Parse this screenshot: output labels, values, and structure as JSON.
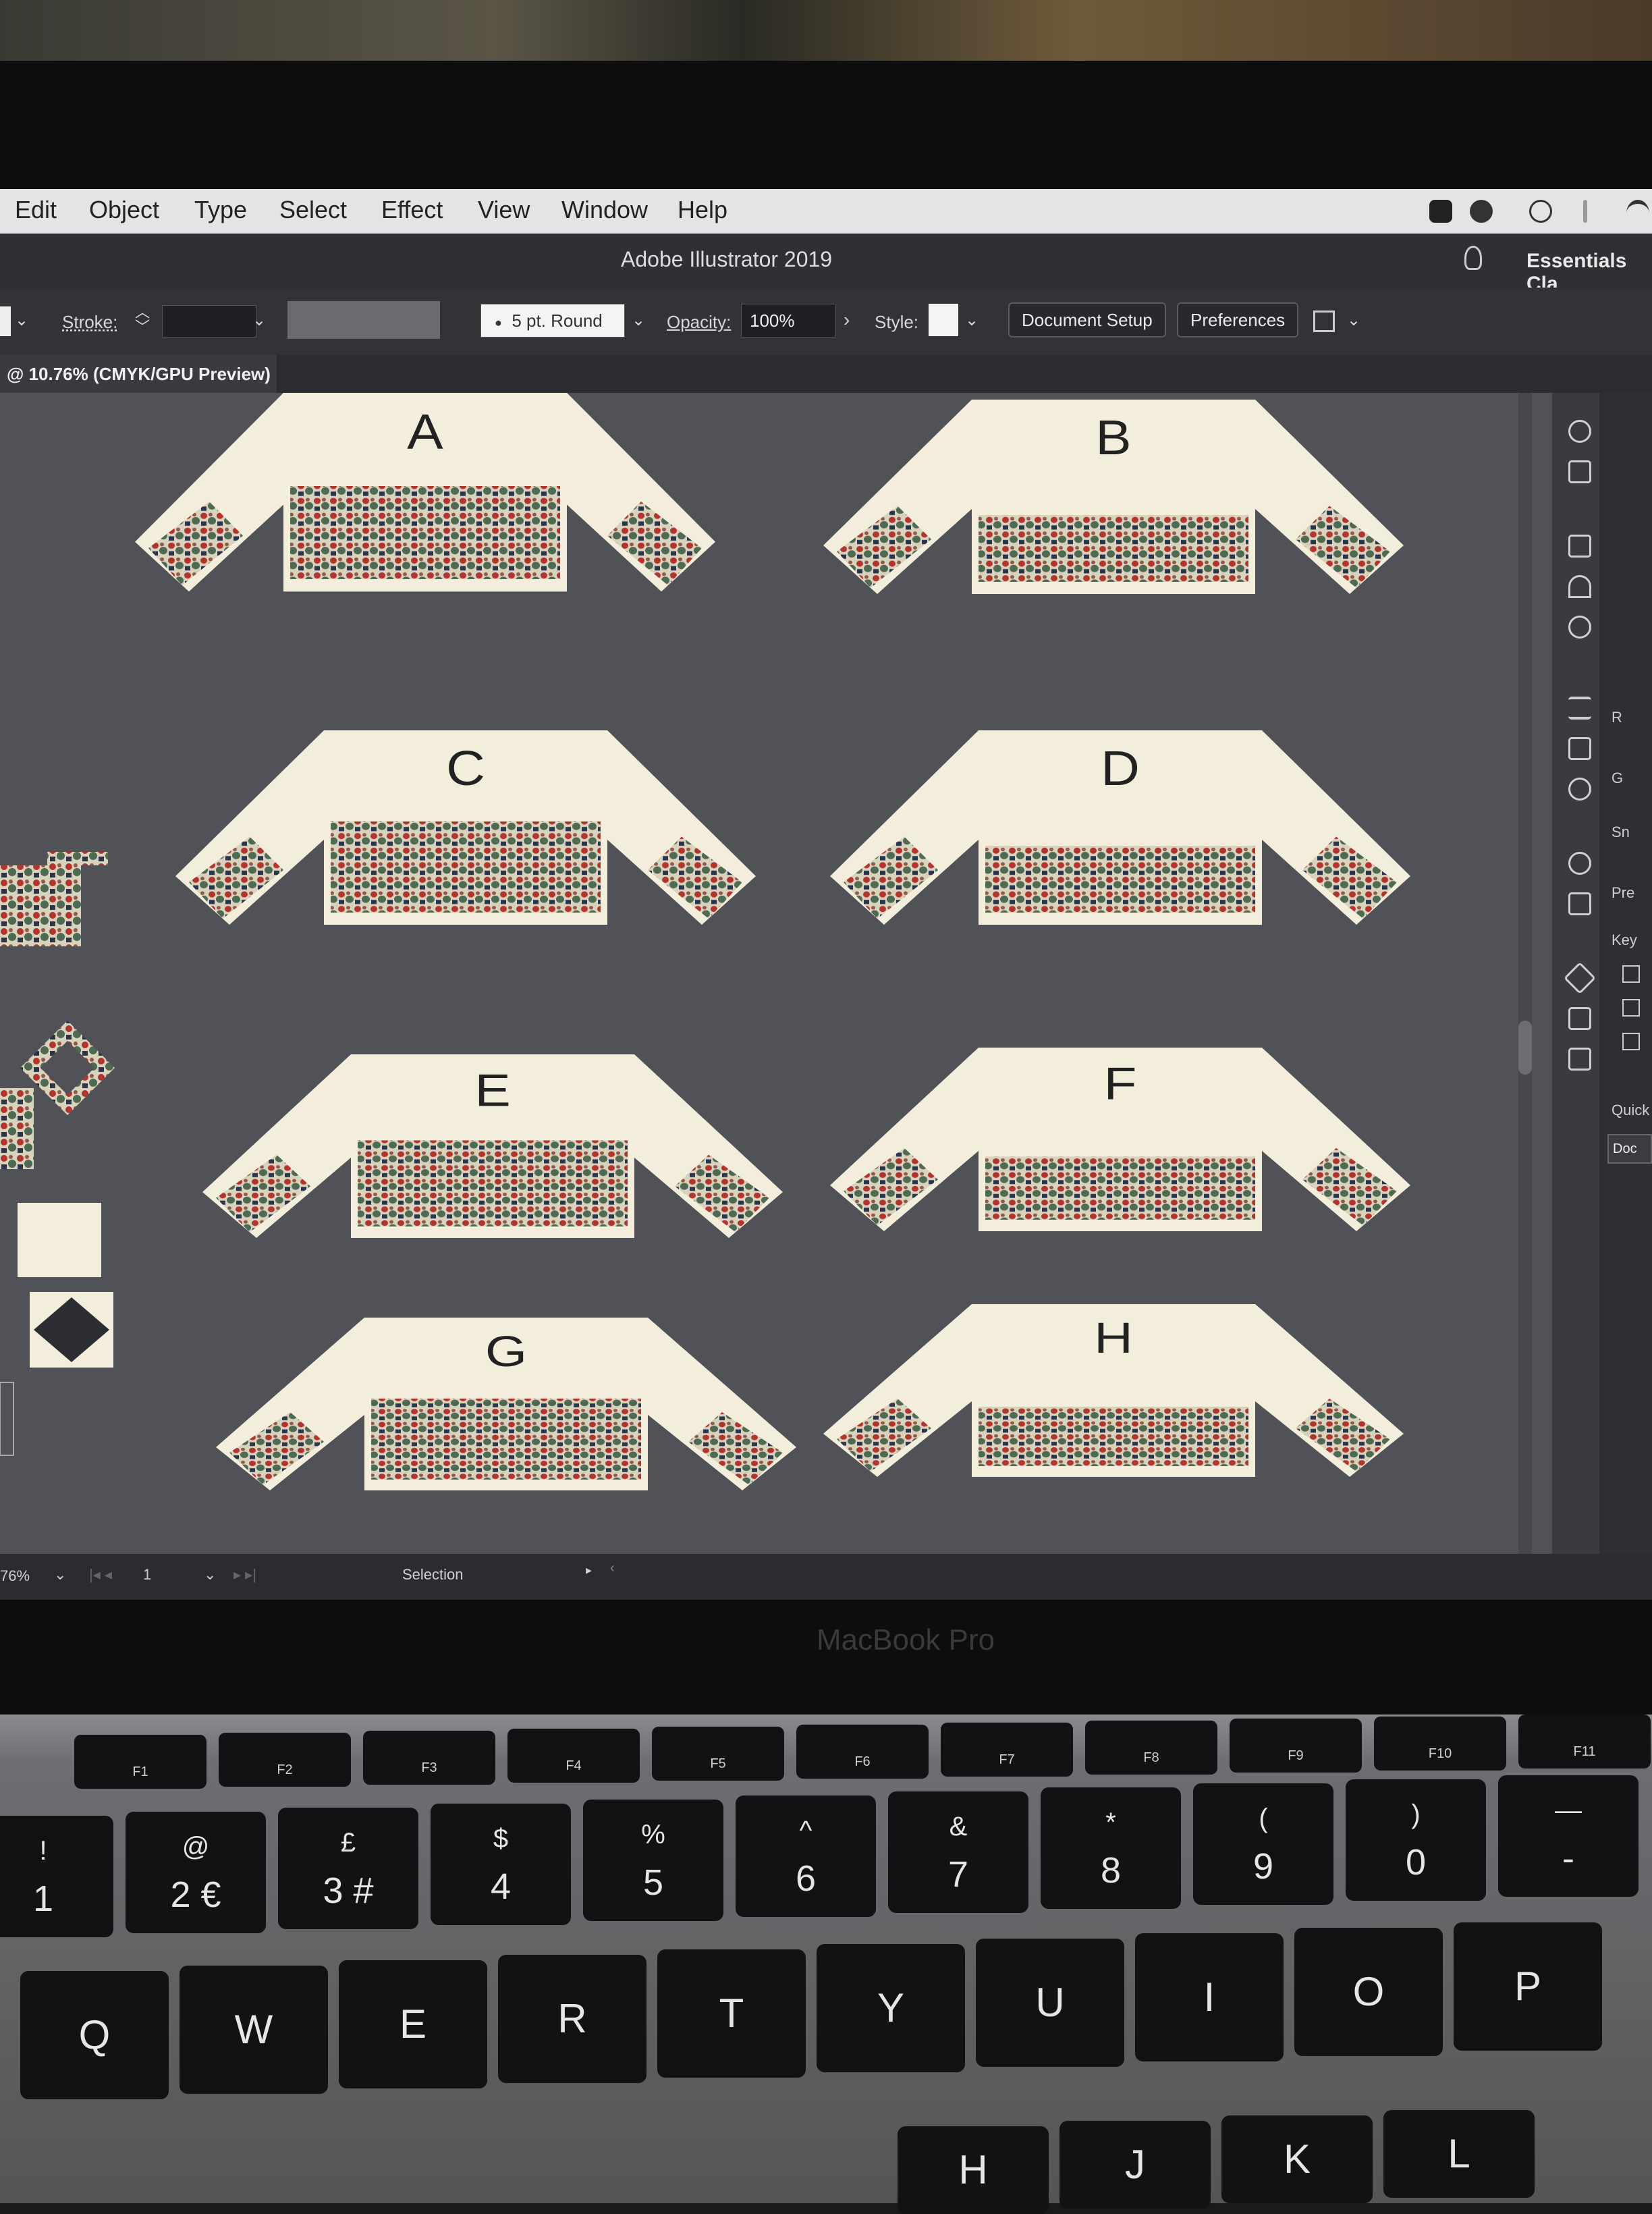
{
  "menu": {
    "items": [
      "Edit",
      "Object",
      "Type",
      "Select",
      "Effect",
      "View",
      "Window",
      "Help"
    ]
  },
  "title_bar": {
    "title": "Adobe Illustrator 2019",
    "workspace": "Essentials Cla"
  },
  "control_bar": {
    "stroke_label": "Stroke:",
    "brush": "5 pt. Round",
    "opacity_label": "Opacity:",
    "opacity_value": "100%",
    "style_label": "Style:",
    "document_setup": "Document Setup",
    "preferences": "Preferences"
  },
  "document_tab": {
    "label": "@ 10.76% (CMYK/GPU Preview)"
  },
  "artboards": {
    "labels": [
      "A",
      "B",
      "C",
      "D",
      "E",
      "F",
      "G",
      "H"
    ]
  },
  "right_panel": {
    "labels": [
      "R",
      "G",
      "Sn",
      "Pre",
      "Key",
      "Quick",
      "Doc"
    ]
  },
  "status_bar": {
    "zoom": "76%",
    "artboard_number": "1",
    "tool": "Selection"
  },
  "hardware": {
    "brand": "MacBook Pro"
  },
  "keyboard": {
    "function_keys": [
      "F1",
      "F2",
      "F3",
      "F4",
      "F5",
      "F6",
      "F7",
      "F8",
      "F9",
      "F10",
      "F11"
    ],
    "number_row": [
      {
        "top": "!",
        "bottom": "1"
      },
      {
        "top": "@",
        "bottom": "2 €"
      },
      {
        "top": "£",
        "bottom": "3 #"
      },
      {
        "top": "$",
        "bottom": "4"
      },
      {
        "top": "%",
        "bottom": "5"
      },
      {
        "top": "^",
        "bottom": "6"
      },
      {
        "top": "&",
        "bottom": "7"
      },
      {
        "top": "*",
        "bottom": "8"
      },
      {
        "top": "(",
        "bottom": "9"
      },
      {
        "top": ")",
        "bottom": "0"
      },
      {
        "top": "—",
        "bottom": "-"
      }
    ],
    "letter_row": [
      "Q",
      "W",
      "E",
      "R",
      "T",
      "Y",
      "U",
      "I",
      "O",
      "P"
    ],
    "home_row_partial": [
      "H",
      "J",
      "K",
      "L"
    ]
  },
  "colors": {
    "canvas": "#505258",
    "artboard": "#f2eedb",
    "accent_red": "#b2342e",
    "accent_green": "#4e6a52",
    "accent_navy": "#2b3550"
  }
}
